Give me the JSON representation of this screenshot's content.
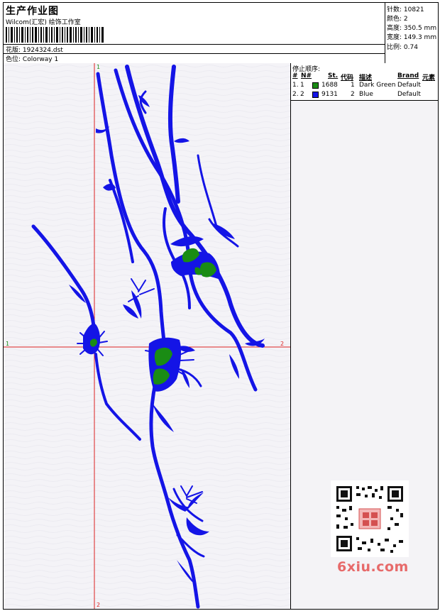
{
  "header": {
    "title": "生产作业图",
    "company": "Wilcom(汇宏) 绘饰工作室",
    "design_label": "花版:",
    "design_value": "1924324.dst",
    "colorway_label": "色位:",
    "colorway_value": "Colorway 1"
  },
  "stats": [
    {
      "label": "针数:",
      "value": "10821"
    },
    {
      "label": "颜色:",
      "value": "2"
    },
    {
      "label": "高度:",
      "value": "350.5 mm"
    },
    {
      "label": "宽度:",
      "value": "149.3 mm"
    },
    {
      "label": "比例:",
      "value": "0.74"
    }
  ],
  "stop_sequence": {
    "title": "停止顺序:",
    "columns": [
      "#",
      "N#",
      "St.",
      "代码",
      "描述",
      "Brand",
      "元素"
    ],
    "rows": [
      {
        "num": "1.",
        "n": "1",
        "stitches": "1688",
        "code": "1",
        "desc": "Dark Green",
        "brand": "Default",
        "color": "#1a8c14"
      },
      {
        "num": "2.",
        "n": "2",
        "stitches": "9131",
        "code": "2",
        "desc": "Blue",
        "brand": "Default",
        "color": "#1414e6"
      }
    ]
  },
  "axes": {
    "v_top": "1",
    "v_bottom": "2",
    "h_left": "1",
    "h_right": "2"
  },
  "colors": {
    "blue": "#1414e6",
    "green": "#1a8c14",
    "crosshair": "#dd2222",
    "watermark": "#e76a6a"
  },
  "watermark": "6xiu.com"
}
